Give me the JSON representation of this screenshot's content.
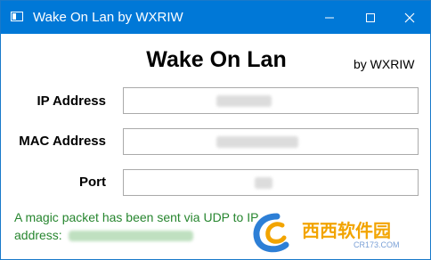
{
  "window": {
    "title": "Wake On Lan by WXRIW",
    "accent_color": "#0078d7"
  },
  "titlebar_controls": {
    "minimize_icon": "minimize-icon",
    "maximize_icon": "maximize-icon",
    "close_icon": "close-icon"
  },
  "header": {
    "title": "Wake On Lan",
    "byline": "by WXRIW"
  },
  "form": {
    "ip_label": "IP Address",
    "ip_value": "",
    "mac_label": "MAC Address",
    "mac_value": "",
    "port_label": "Port",
    "port_value": ""
  },
  "status": {
    "line1": "A magic packet has been sent via UDP to IP",
    "line2": "address: ",
    "color": "#27862f"
  },
  "watermark": {
    "title": "西西软件园",
    "url": "CR173.COM"
  }
}
